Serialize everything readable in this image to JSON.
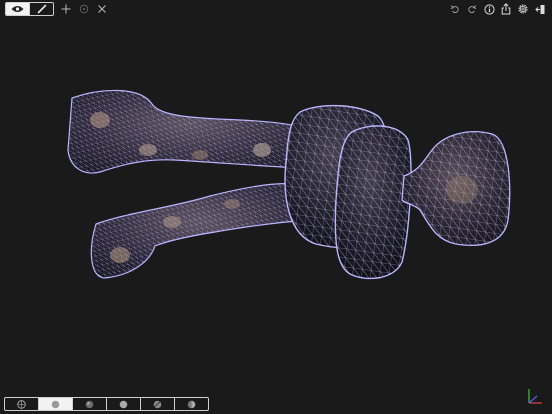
{
  "toolbar": {
    "mode_toggle": [
      {
        "icon": "eye-icon",
        "selected": true
      },
      {
        "icon": "brush-icon",
        "selected": false
      }
    ],
    "tools": [
      "move-icon",
      "pivot-icon",
      "cut-icon"
    ],
    "right_icons": [
      "undo-icon",
      "redo-icon",
      "info-icon",
      "share-icon",
      "gear-icon",
      "exit-icon"
    ]
  },
  "render_modes": {
    "selected_index": 1,
    "items": [
      "wireframe-sphere-icon",
      "solid-sphere-icon",
      "shaded-sphere-icon",
      "matcap-sphere-icon",
      "striped-sphere-icon",
      "half-sphere-icon"
    ]
  },
  "colors": {
    "background": "#1a1a1a",
    "wireframe": "#b9b5ff",
    "ui_stroke": "#cfcfcf",
    "axis_x": "#e04040",
    "axis_y": "#40c040",
    "axis_z": "#5060ff"
  }
}
